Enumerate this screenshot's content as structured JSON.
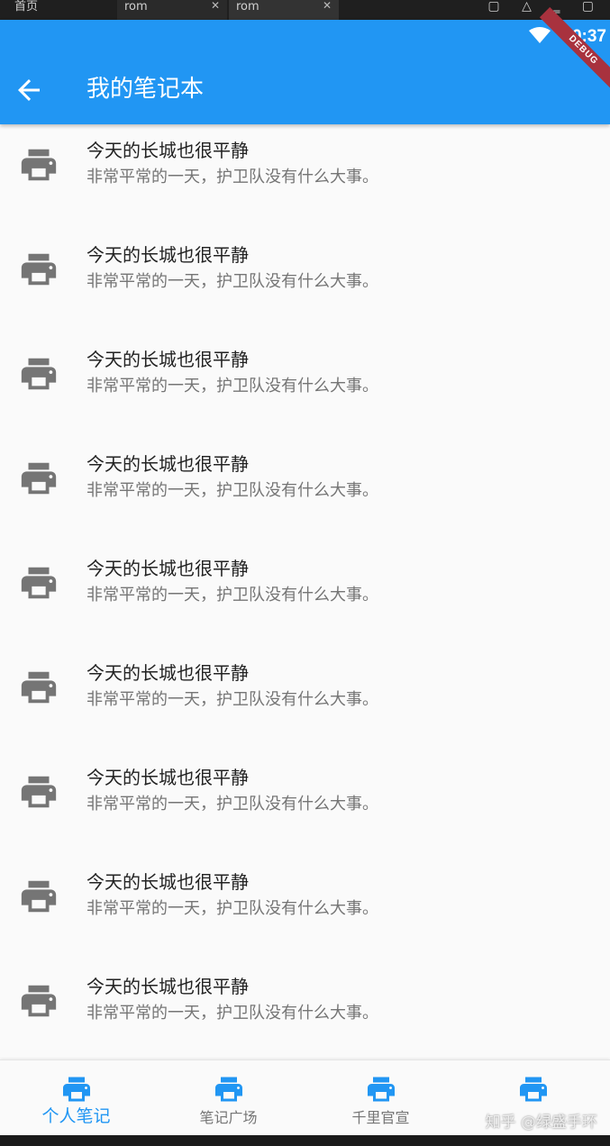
{
  "window": {
    "tabs": [
      "首页",
      "rom",
      "rom"
    ],
    "close_symbol": "✕"
  },
  "status_bar": {
    "time": "10:37",
    "wifi_icon": "wifi-icon",
    "debug_banner": "DEBUG"
  },
  "appbar": {
    "back_icon": "arrow-back-icon",
    "title": "我的笔记本",
    "background": "#2196f3"
  },
  "list": {
    "leading_icon": "print-icon",
    "items": [
      {
        "title": "今天的长城也很平静",
        "subtitle": "非常平常的一天，护卫队没有什么大事。"
      },
      {
        "title": "今天的长城也很平静",
        "subtitle": "非常平常的一天，护卫队没有什么大事。"
      },
      {
        "title": "今天的长城也很平静",
        "subtitle": "非常平常的一天，护卫队没有什么大事。"
      },
      {
        "title": "今天的长城也很平静",
        "subtitle": "非常平常的一天，护卫队没有什么大事。"
      },
      {
        "title": "今天的长城也很平静",
        "subtitle": "非常平常的一天，护卫队没有什么大事。"
      },
      {
        "title": "今天的长城也很平静",
        "subtitle": "非常平常的一天，护卫队没有什么大事。"
      },
      {
        "title": "今天的长城也很平静",
        "subtitle": "非常平常的一天，护卫队没有什么大事。"
      },
      {
        "title": "今天的长城也很平静",
        "subtitle": "非常平常的一天，护卫队没有什么大事。"
      },
      {
        "title": "今天的长城也很平静",
        "subtitle": "非常平常的一天，护卫队没有什么大事。"
      }
    ]
  },
  "bottom_nav": {
    "active_color": "#2196f3",
    "inactive_color": "#757575",
    "items": [
      {
        "label": "个人笔记",
        "icon": "print-icon",
        "active": true
      },
      {
        "label": "笔记广场",
        "icon": "print-icon",
        "active": false
      },
      {
        "label": "千里官宣",
        "icon": "print-icon",
        "active": false
      },
      {
        "label": "",
        "icon": "print-icon",
        "active": false
      }
    ],
    "watermark": "知乎 @绿盛手环"
  }
}
